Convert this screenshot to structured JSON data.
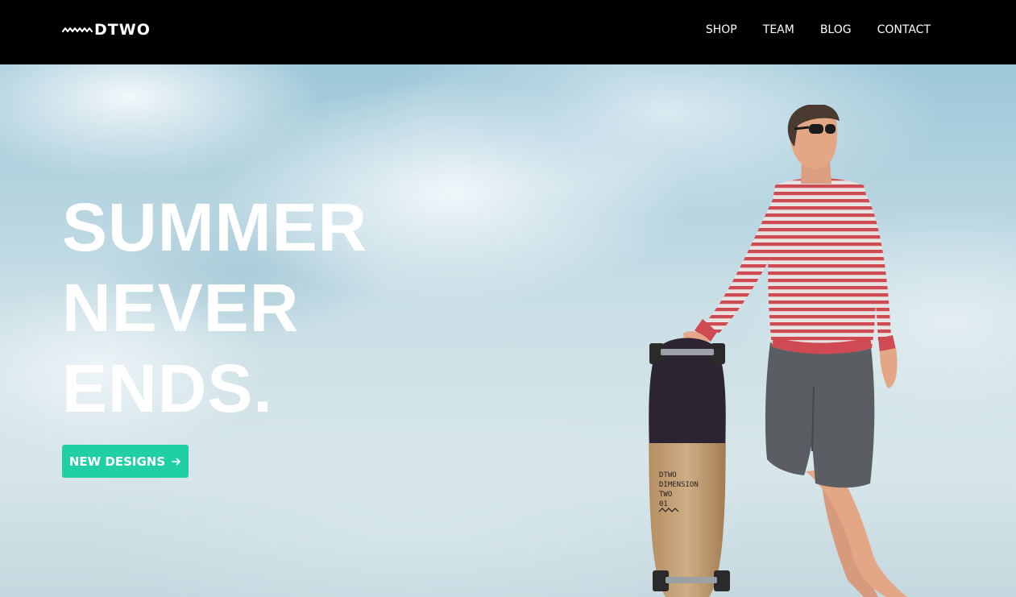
{
  "header": {
    "logo_text": "DTWO",
    "nav": [
      {
        "label": "SHOP"
      },
      {
        "label": "TEAM"
      },
      {
        "label": "BLOG"
      },
      {
        "label": "CONTACT"
      }
    ]
  },
  "hero": {
    "headline": [
      "SUMMER",
      "NEVER",
      "ENDS."
    ],
    "cta_label": "NEW DESIGNS",
    "cta_icon": "arrow-right-icon",
    "board_print": [
      "DTWO",
      "DIMENSION",
      "TWO",
      "01"
    ]
  },
  "colors": {
    "header_bg": "#000000",
    "accent": "#20cfa4",
    "text": "#ffffff"
  }
}
